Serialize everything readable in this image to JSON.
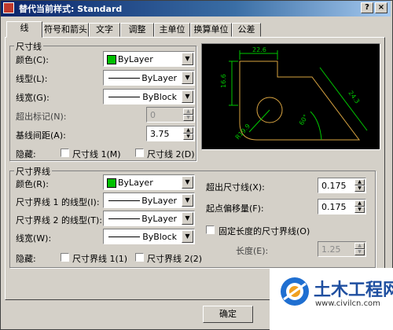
{
  "window": {
    "title": "替代当前样式: Standard",
    "min": "_",
    "close": "×"
  },
  "tabs": [
    "线",
    "符号和箭头",
    "文字",
    "调整",
    "主单位",
    "换算单位",
    "公差"
  ],
  "dim_lines": {
    "group_title": "尺寸线",
    "color_label": "颜色(C):",
    "color_value": "ByLayer",
    "color_hex": "#00c000",
    "linetype_label": "线型(L):",
    "linetype_value": "ByLayer",
    "lineweight_label": "线宽(G):",
    "lineweight_value": "ByBlock",
    "extend_ticks_label": "超出标记(N):",
    "extend_ticks_value": "0",
    "baseline_label": "基线间距(A):",
    "baseline_value": "3.75",
    "suppress_label": "隐藏:",
    "suppress_1": "尺寸线 1(M)",
    "suppress_2": "尺寸线 2(D)"
  },
  "ext_lines": {
    "group_title": "尺寸界线",
    "color_label": "颜色(R):",
    "color_value": "ByLayer",
    "color_hex": "#00c000",
    "lt1_label": "尺寸界线 1 的线型(I):",
    "lt1_value": "ByLayer",
    "lt2_label": "尺寸界线 2 的线型(T):",
    "lt2_value": "ByLayer",
    "lineweight_label": "线宽(W):",
    "lineweight_value": "ByBlock",
    "suppress_label": "隐藏:",
    "suppress_1": "尺寸界线 1(1)",
    "suppress_2": "尺寸界线 2(2)",
    "extend_label": "超出尺寸线(X):",
    "extend_value": "0.175",
    "offset_label": "起点偏移量(F):",
    "offset_value": "0.175",
    "fixed_label": "固定长度的尺寸界线(O)",
    "length_label": "长度(E):",
    "length_value": "1.25"
  },
  "preview": {
    "dims": [
      "22.6",
      "16.6",
      "24.3",
      "R19.9",
      "60°"
    ]
  },
  "footer": {
    "ok": "确定"
  },
  "watermark": {
    "brand": "土木工程网",
    "url": "www.civilcn.com"
  },
  "colors": {
    "preview_bg": "#000000",
    "preview_geometry": "#d9a441",
    "preview_dims": "#00c800",
    "title_bar": "#0a246a"
  }
}
